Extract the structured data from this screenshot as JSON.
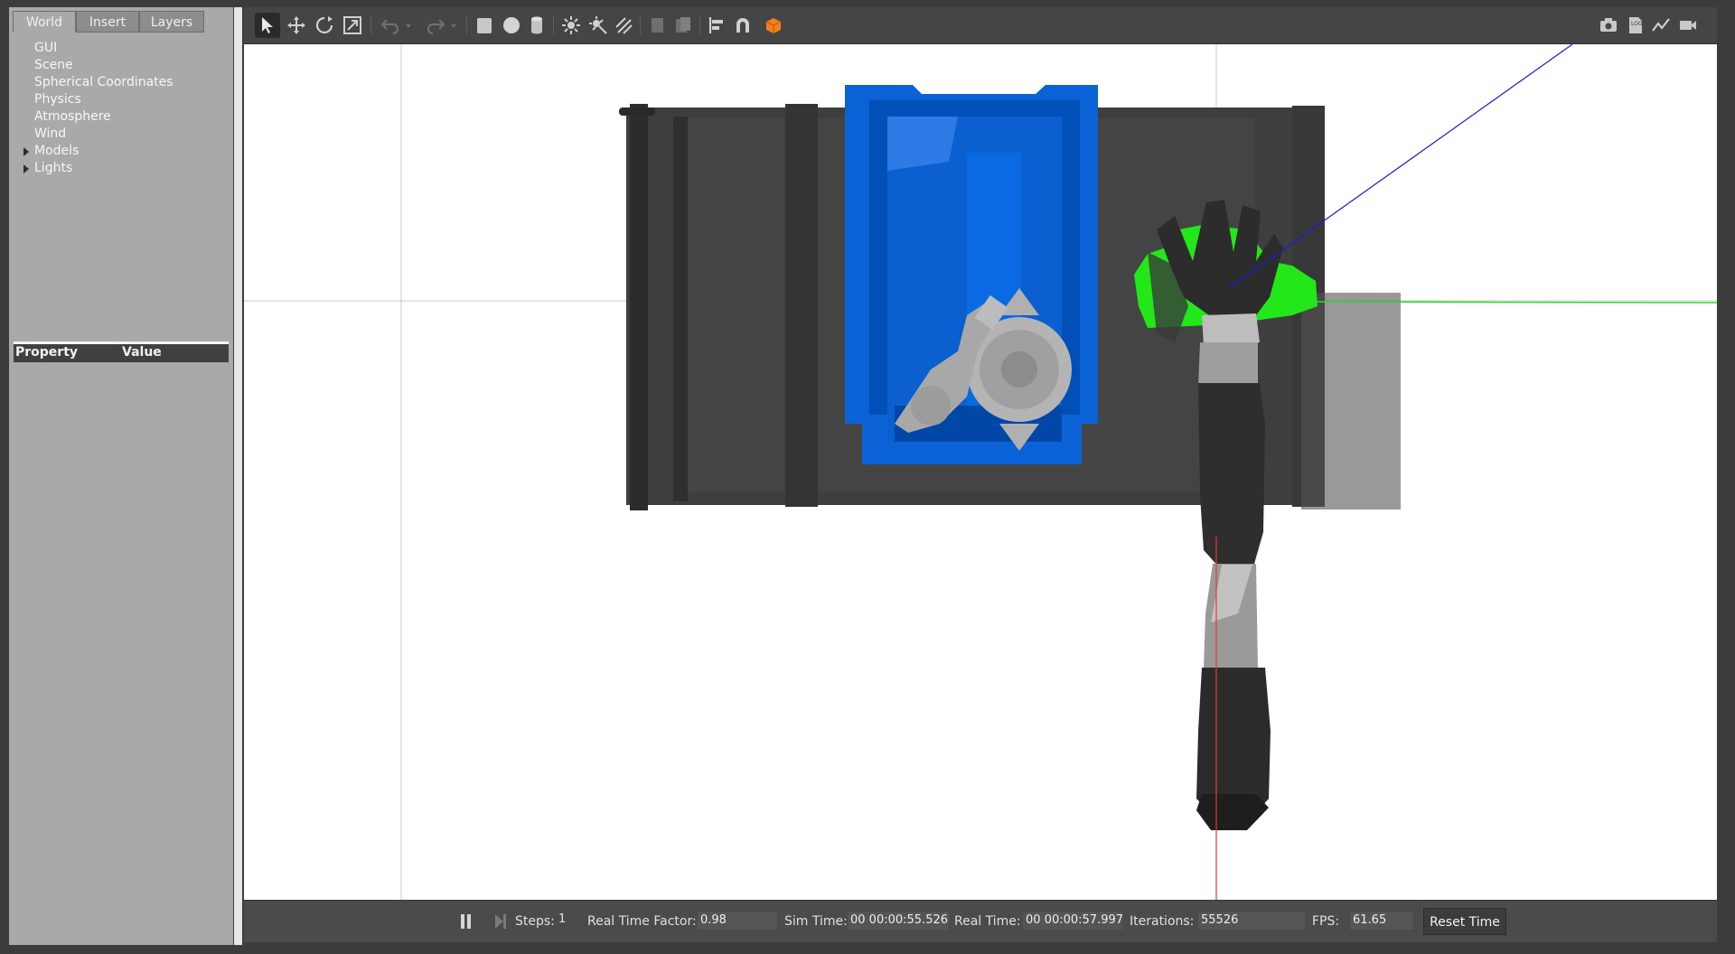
{
  "left_panel": {
    "tabs": [
      {
        "label": "World",
        "active": true
      },
      {
        "label": "Insert",
        "active": false
      },
      {
        "label": "Layers",
        "active": false
      }
    ],
    "tree": [
      {
        "label": "GUI",
        "expandable": false
      },
      {
        "label": "Scene",
        "expandable": false
      },
      {
        "label": "Spherical Coordinates",
        "expandable": false
      },
      {
        "label": "Physics",
        "expandable": false
      },
      {
        "label": "Atmosphere",
        "expandable": false
      },
      {
        "label": "Wind",
        "expandable": false
      },
      {
        "label": "Models",
        "expandable": true
      },
      {
        "label": "Lights",
        "expandable": true
      }
    ],
    "property_header": {
      "property": "Property",
      "value": "Value"
    }
  },
  "toolbar": {
    "tools": [
      "select-arrow-icon",
      "translate-icon",
      "rotate-icon",
      "scale-icon",
      "undo-icon",
      "undo-dropdown-icon",
      "redo-icon",
      "redo-dropdown-icon",
      "box-icon",
      "sphere-icon",
      "cylinder-icon",
      "point-light-icon",
      "spot-light-icon",
      "directional-light-icon",
      "copy-icon",
      "paste-icon",
      "align-icon",
      "snap-magnet-icon",
      "view-angle-cube-icon"
    ],
    "right_tools": [
      "screenshot-camera-icon",
      "log-icon",
      "plot-icon",
      "video-record-icon"
    ],
    "accent": "#f07f1c"
  },
  "statusbar": {
    "steps_label": "Steps:",
    "steps_value": "1",
    "rtf_label": "Real Time Factor:",
    "rtf_value": "0.98",
    "sim_time_label": "Sim Time:",
    "sim_time_value": "00 00:00:55.526",
    "real_time_label": "Real Time:",
    "real_time_value": "00 00:00:57.997",
    "iterations_label": "Iterations:",
    "iterations_value": "55526",
    "fps_label": "FPS:",
    "fps_value": "61.65",
    "reset_label": "Reset Time"
  },
  "scene_colors": {
    "bin": "#0a62d6",
    "table": "#3a3a3a",
    "highlight": "#22e81a",
    "axis_x": "#ff3030",
    "axis_y": "#2edc2e",
    "axis_z": "#1a1ae6"
  }
}
